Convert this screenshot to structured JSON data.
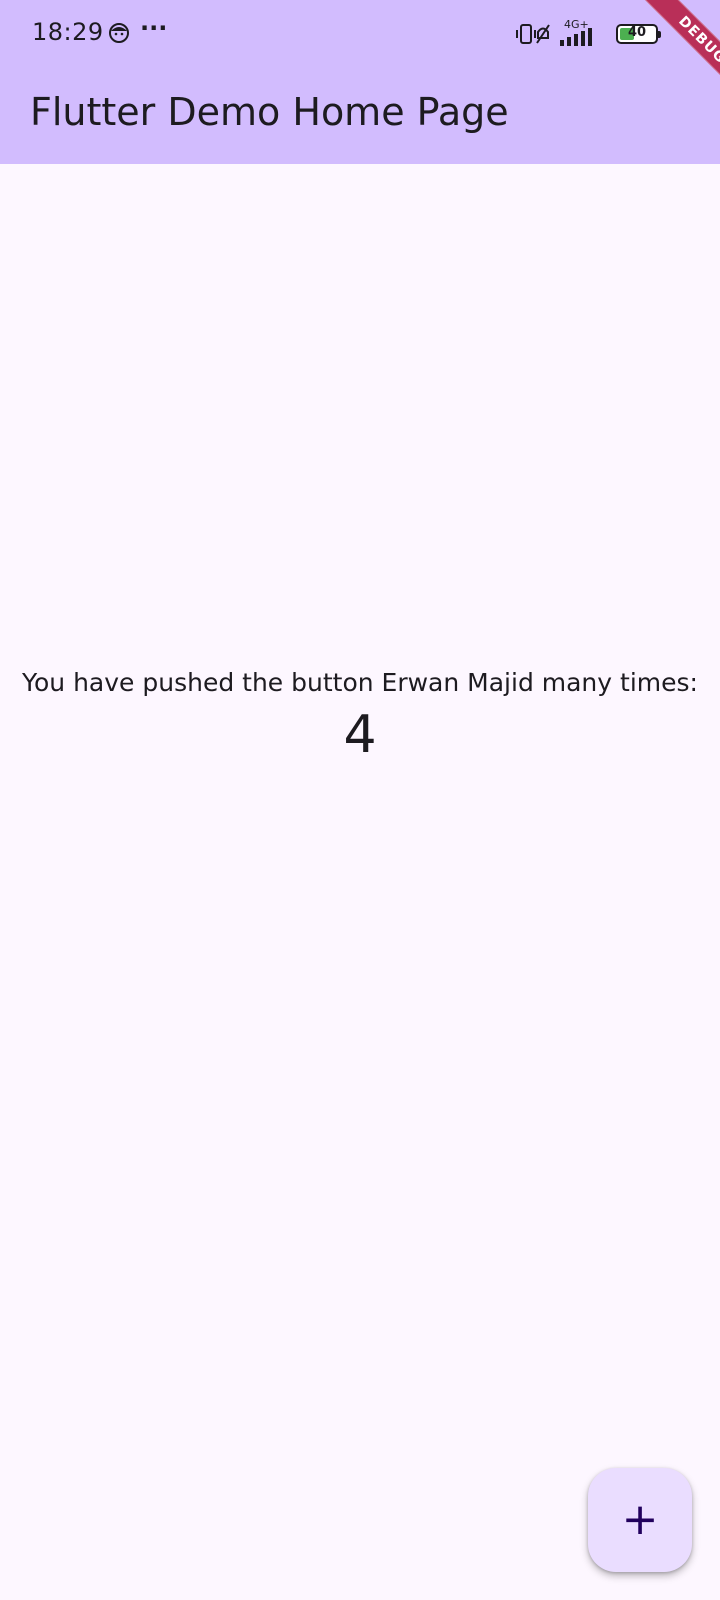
{
  "colors": {
    "app_bar": "#d2bcfe",
    "background": "#fdf7ff",
    "fab": "#eaddff",
    "debug_banner": "#b00020",
    "battery_fill": "#4caf50"
  },
  "status_bar": {
    "time": "18:29",
    "more": "···",
    "network": "4G+",
    "battery_level": "40",
    "icons": [
      "face-icon",
      "more-icon",
      "vibrate-icon",
      "mute-icon",
      "signal-icon",
      "battery-icon"
    ]
  },
  "app_bar": {
    "title": "Flutter Demo Home Page"
  },
  "debug_banner": {
    "label": "DEBUG"
  },
  "counter": {
    "label": "You have pushed the button Erwan Majid many times:",
    "value": "4"
  },
  "fab": {
    "icon": "add-icon",
    "glyph": "+"
  }
}
